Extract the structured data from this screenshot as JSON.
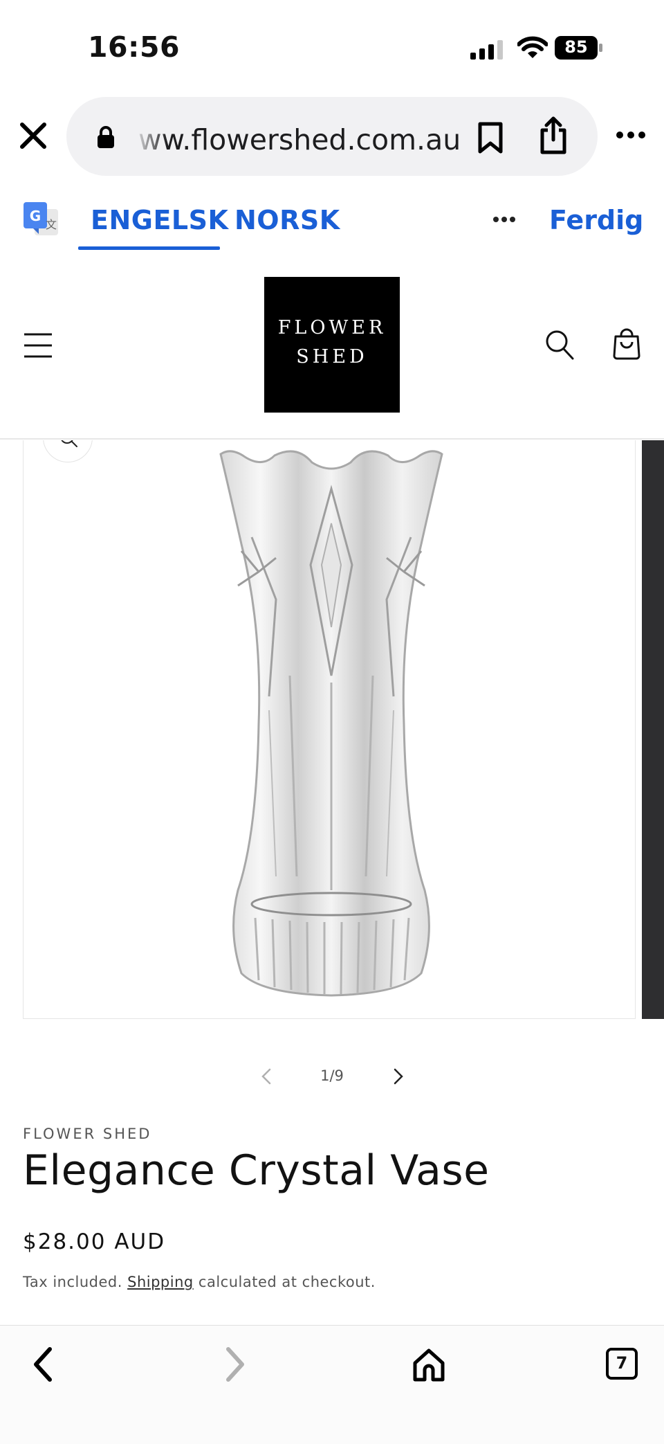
{
  "status_bar": {
    "time": "16:56",
    "battery": "85"
  },
  "browser": {
    "url": "ww.flowershed.com.au",
    "icons": [
      "close-icon",
      "lock-icon",
      "bookmark-icon",
      "share-icon",
      "more-icon"
    ]
  },
  "translate_bar": {
    "source_lang": "ENGELSK",
    "target_lang": "NORSK",
    "done_label": "Ferdig"
  },
  "store": {
    "logo_line1": "FLOWER",
    "logo_line2": "SHED"
  },
  "gallery": {
    "counter": "1/9",
    "image": "crystal-vase"
  },
  "product": {
    "vendor": "FLOWER SHED",
    "title": "Elegance Crystal Vase",
    "price": "$28.00 AUD",
    "tax_prefix": "Tax included.",
    "shipping_link": "Shipping",
    "tax_suffix": "calculated at checkout."
  },
  "toolbar": {
    "tabs_count": "7"
  },
  "colors": {
    "accent_blue": "#1a5fd6",
    "logo_bg": "#000000"
  }
}
